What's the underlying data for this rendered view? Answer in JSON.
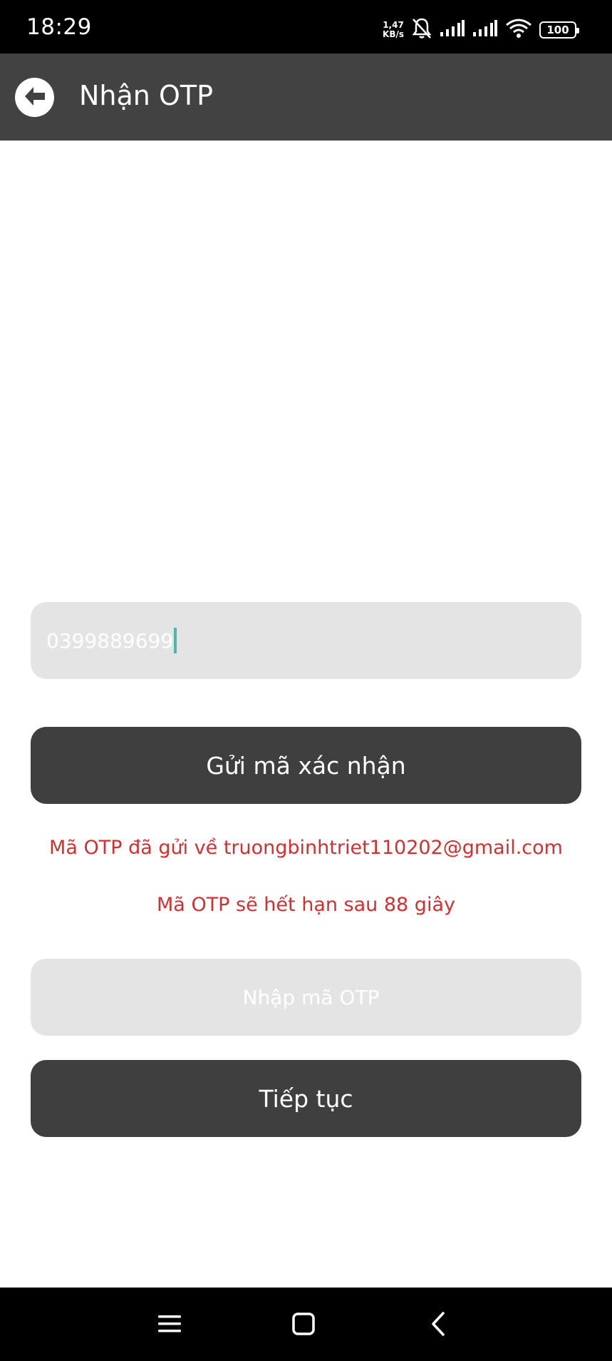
{
  "status_bar": {
    "time": "18:29",
    "net_speed_value": "1,47",
    "net_speed_unit": "KB/s",
    "battery": "100",
    "icons": [
      "bell-muted-icon",
      "signal-icon",
      "signal-icon",
      "wifi-icon",
      "battery-icon"
    ]
  },
  "app_bar": {
    "title": "Nhận OTP",
    "back_icon": "arrow-left-circle-icon"
  },
  "form": {
    "phone_value": "0399889699",
    "send_button_label": "Gửi mã xác nhận",
    "sent_notice": "Mã OTP đã gửi về truongbinhtriet110202@gmail.com",
    "expiry_notice": "Mã OTP sẽ hết hạn sau 88 giây",
    "otp_placeholder": "Nhập mã OTP",
    "otp_value": "",
    "continue_button_label": "Tiếp tục"
  },
  "colors": {
    "app_bar": "#424242",
    "button": "#3f3f3f",
    "field": "#e4e4e4",
    "notice": "#d32f2f",
    "caret": "#4db6ac"
  },
  "nav_bar": {
    "icons": [
      "menu-icon",
      "home-square-icon",
      "back-chevron-icon"
    ]
  }
}
